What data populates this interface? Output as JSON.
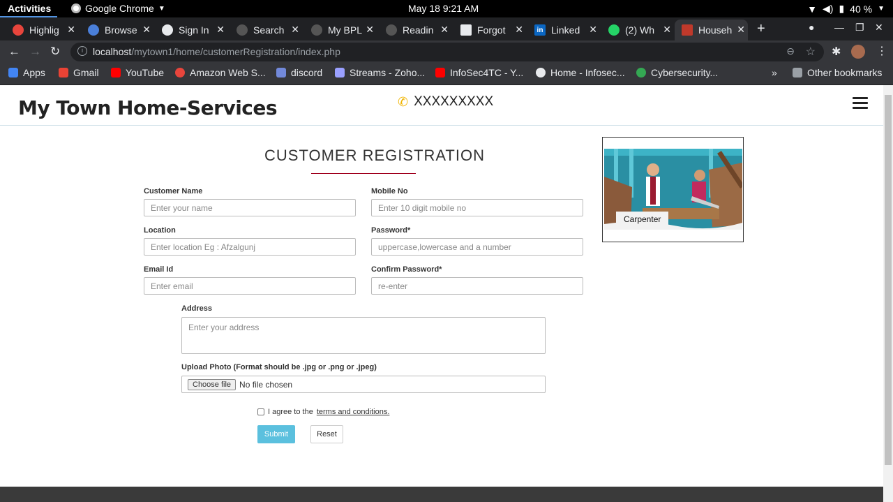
{
  "system": {
    "activities": "Activities",
    "app_name": "Google Chrome",
    "clock": "May 18  9:21 AM",
    "battery": "40 %"
  },
  "tabs": [
    {
      "title": "Highlig",
      "color": "#e8453c"
    },
    {
      "title": "Browse",
      "color": "#4a7fd9"
    },
    {
      "title": "Sign In",
      "color": "#e8eaed"
    },
    {
      "title": "Search",
      "color": "#555555"
    },
    {
      "title": "My BPL",
      "color": "#555555"
    },
    {
      "title": "Readin",
      "color": "#555555"
    },
    {
      "title": "Forgot",
      "color": "#e8eaed"
    },
    {
      "title": "Linked",
      "color": "#0a66c2"
    },
    {
      "title": "(2) Wh",
      "color": "#25d366"
    },
    {
      "title": "Househ",
      "color": "#c0392b"
    }
  ],
  "browser": {
    "url_host": "localhost",
    "url_path": "/mytown1/home/customerRegistration/index.php"
  },
  "bookmarks": [
    {
      "label": "Apps",
      "color": "#4285f4"
    },
    {
      "label": "Gmail",
      "color": "#ea4335"
    },
    {
      "label": "YouTube",
      "color": "#ff0000"
    },
    {
      "label": "Amazon Web S...",
      "color": "#e8453c"
    },
    {
      "label": "discord",
      "color": "#7289da"
    },
    {
      "label": "Streams - Zoho...",
      "color": "#9aa0ff"
    },
    {
      "label": "InfoSec4TC - Y...",
      "color": "#ff0000"
    },
    {
      "label": "Home - Infosec...",
      "color": "#e8eaed"
    },
    {
      "label": "Cybersecurity...",
      "color": "#34a853"
    },
    {
      "label": "Other bookmarks",
      "color": "#9aa0a6"
    }
  ],
  "site": {
    "brand": "My Town Home-Services",
    "phone": "XXXXXXXXX"
  },
  "form": {
    "title": "CUSTOMER REGISTRATION",
    "customer_name_label": "Customer Name",
    "customer_name_placeholder": "Enter your name",
    "mobile_label": "Mobile No",
    "mobile_placeholder": "Enter 10 digit mobile no",
    "location_label": "Location",
    "location_placeholder": "Enter location Eg : Afzalgunj",
    "password_label": "Password*",
    "password_placeholder": "uppercase,lowercase and a number",
    "email_label": "Email Id",
    "email_placeholder": "Enter email",
    "confirm_label": "Confirm Password*",
    "confirm_placeholder": "re-enter",
    "address_label": "Address",
    "address_placeholder": "Enter your address",
    "photo_label": "Upload Photo (Format should be .jpg or .png or .jpeg)",
    "choose_file": "Choose file",
    "no_file": "No file chosen",
    "agree_text": "I agree to the",
    "terms_link": "terms and conditions.",
    "submit": "Submit",
    "reset": "Reset"
  },
  "promo": {
    "caption": "Carpenter"
  }
}
